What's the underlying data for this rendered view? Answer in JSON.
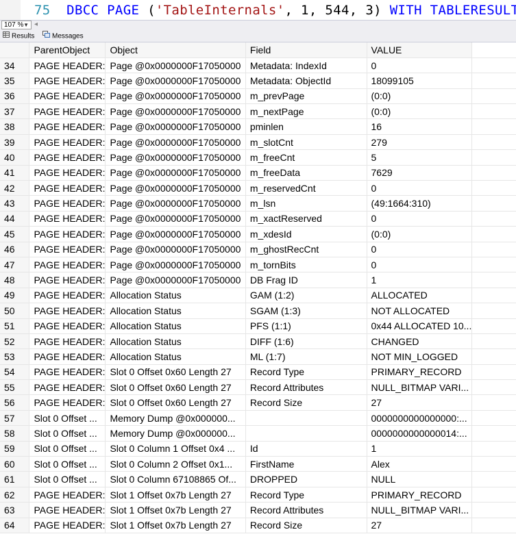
{
  "editor": {
    "line_number": "75",
    "code": {
      "kw1": "DBCC PAGE",
      "open": " (",
      "str": "'TableInternals'",
      "args": ", 1, 544, 3)",
      "kw2": " WITH TABLERESULTS;"
    }
  },
  "zoom": {
    "value": "107 %"
  },
  "tabs": {
    "results": "Results",
    "messages": "Messages"
  },
  "grid": {
    "columns": [
      "ParentObject",
      "Object",
      "Field",
      "VALUE"
    ],
    "rows": [
      [
        "34",
        "PAGE HEADER:",
        "Page @0x0000000F17050000",
        "Metadata: IndexId",
        "0"
      ],
      [
        "35",
        "PAGE HEADER:",
        "Page @0x0000000F17050000",
        "Metadata: ObjectId",
        "18099105"
      ],
      [
        "36",
        "PAGE HEADER:",
        "Page @0x0000000F17050000",
        "m_prevPage",
        "(0:0)"
      ],
      [
        "37",
        "PAGE HEADER:",
        "Page @0x0000000F17050000",
        "m_nextPage",
        "(0:0)"
      ],
      [
        "38",
        "PAGE HEADER:",
        "Page @0x0000000F17050000",
        "pminlen",
        "16"
      ],
      [
        "39",
        "PAGE HEADER:",
        "Page @0x0000000F17050000",
        "m_slotCnt",
        "279"
      ],
      [
        "40",
        "PAGE HEADER:",
        "Page @0x0000000F17050000",
        "m_freeCnt",
        "5"
      ],
      [
        "41",
        "PAGE HEADER:",
        "Page @0x0000000F17050000",
        "m_freeData",
        "7629"
      ],
      [
        "42",
        "PAGE HEADER:",
        "Page @0x0000000F17050000",
        "m_reservedCnt",
        "0"
      ],
      [
        "43",
        "PAGE HEADER:",
        "Page @0x0000000F17050000",
        "m_lsn",
        "(49:1664:310)"
      ],
      [
        "44",
        "PAGE HEADER:",
        "Page @0x0000000F17050000",
        "m_xactReserved",
        "0"
      ],
      [
        "45",
        "PAGE HEADER:",
        "Page @0x0000000F17050000",
        "m_xdesId",
        "(0:0)"
      ],
      [
        "46",
        "PAGE HEADER:",
        "Page @0x0000000F17050000",
        "m_ghostRecCnt",
        "0"
      ],
      [
        "47",
        "PAGE HEADER:",
        "Page @0x0000000F17050000",
        "m_tornBits",
        "0"
      ],
      [
        "48",
        "PAGE HEADER:",
        "Page @0x0000000F17050000",
        "DB Frag ID",
        "1"
      ],
      [
        "49",
        "PAGE HEADER:",
        "Allocation Status",
        "GAM (1:2)",
        "ALLOCATED"
      ],
      [
        "50",
        "PAGE HEADER:",
        "Allocation Status",
        "SGAM (1:3)",
        "NOT ALLOCATED"
      ],
      [
        "51",
        "PAGE HEADER:",
        "Allocation Status",
        "PFS (1:1)",
        "0x44 ALLOCATED 10..."
      ],
      [
        "52",
        "PAGE HEADER:",
        "Allocation Status",
        "DIFF (1:6)",
        "CHANGED"
      ],
      [
        "53",
        "PAGE HEADER:",
        "Allocation Status",
        "ML (1:7)",
        "NOT MIN_LOGGED"
      ],
      [
        "54",
        "PAGE HEADER:",
        "Slot 0 Offset 0x60 Length 27",
        "Record Type",
        "PRIMARY_RECORD"
      ],
      [
        "55",
        "PAGE HEADER:",
        "Slot 0 Offset 0x60 Length 27",
        "Record Attributes",
        " NULL_BITMAP VARI..."
      ],
      [
        "56",
        "PAGE HEADER:",
        "Slot 0 Offset 0x60 Length 27",
        "Record Size",
        "27"
      ],
      [
        "57",
        "Slot 0 Offset ...",
        "Memory Dump @0x000000...",
        "",
        "0000000000000000:..."
      ],
      [
        "58",
        "Slot 0 Offset ...",
        "Memory Dump @0x000000...",
        "",
        "0000000000000014:..."
      ],
      [
        "59",
        "Slot 0 Offset ...",
        "Slot 0 Column 1 Offset 0x4 ...",
        "Id",
        "1"
      ],
      [
        "60",
        "Slot 0 Offset ...",
        "Slot 0 Column 2 Offset 0x1...",
        "FirstName",
        "Alex"
      ],
      [
        "61",
        "Slot 0 Offset ...",
        "Slot 0 Column 67108865 Of...",
        "DROPPED",
        "NULL"
      ],
      [
        "62",
        "PAGE HEADER:",
        "Slot 1 Offset 0x7b Length 27",
        "Record Type",
        "PRIMARY_RECORD"
      ],
      [
        "63",
        "PAGE HEADER:",
        "Slot 1 Offset 0x7b Length 27",
        "Record Attributes",
        " NULL_BITMAP VARI..."
      ],
      [
        "64",
        "PAGE HEADER:",
        "Slot 1 Offset 0x7b Length 27",
        "Record Size",
        "27"
      ]
    ]
  }
}
